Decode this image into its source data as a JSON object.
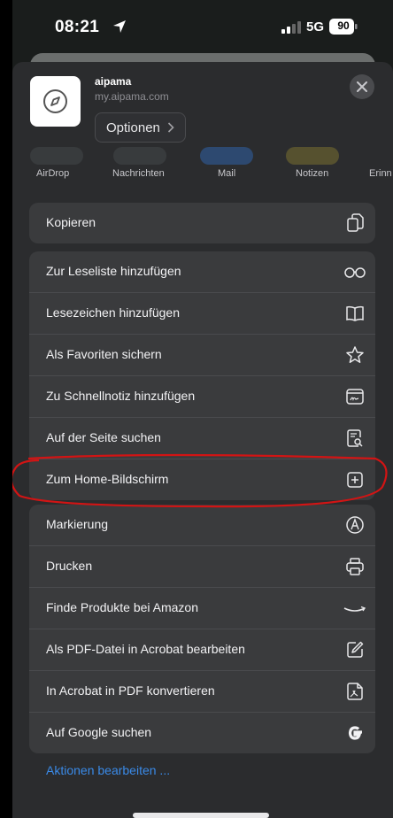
{
  "status_bar": {
    "time": "08:21",
    "network": "5G",
    "battery": "90"
  },
  "header": {
    "site_title": "aipama",
    "site_url": "my.aipama.com",
    "options_label": "Optionen"
  },
  "share_targets": [
    {
      "label": "AirDrop"
    },
    {
      "label": "Nachrichten"
    },
    {
      "label": "Mail"
    },
    {
      "label": "Notizen"
    },
    {
      "label": "Erinn"
    }
  ],
  "copy_section": [
    {
      "label": "Kopieren",
      "icon": "copy-icon"
    }
  ],
  "actions_section": [
    {
      "label": "Zur Leseliste hinzufügen",
      "icon": "reading-list-icon"
    },
    {
      "label": "Lesezeichen hinzufügen",
      "icon": "book-icon"
    },
    {
      "label": "Als Favoriten sichern",
      "icon": "star-icon"
    },
    {
      "label": "Zu Schnellnotiz hinzufügen",
      "icon": "quick-note-icon"
    },
    {
      "label": "Auf der Seite suchen",
      "icon": "find-on-page-icon"
    },
    {
      "label": "Zum Home-Bildschirm",
      "icon": "add-square-icon"
    }
  ],
  "extensions_section": [
    {
      "label": "Markierung",
      "icon": "markup-icon"
    },
    {
      "label": "Drucken",
      "icon": "print-icon"
    },
    {
      "label": "Finde Produkte bei Amazon",
      "icon": "amazon-icon"
    },
    {
      "label": "Als PDF-Datei in Acrobat bearbeiten",
      "icon": "edit-icon"
    },
    {
      "label": "In Acrobat in PDF konvertieren",
      "icon": "acrobat-icon"
    },
    {
      "label": "Auf Google suchen",
      "icon": "google-icon"
    }
  ],
  "edit_actions_label": "Aktionen bearbeiten ...",
  "colors": {
    "background": "#1a1d1c",
    "sheet": "#2b2c2e",
    "row": "#3a3b3d",
    "link": "#3a8ae8",
    "highlight_annotation": "#d21414"
  }
}
